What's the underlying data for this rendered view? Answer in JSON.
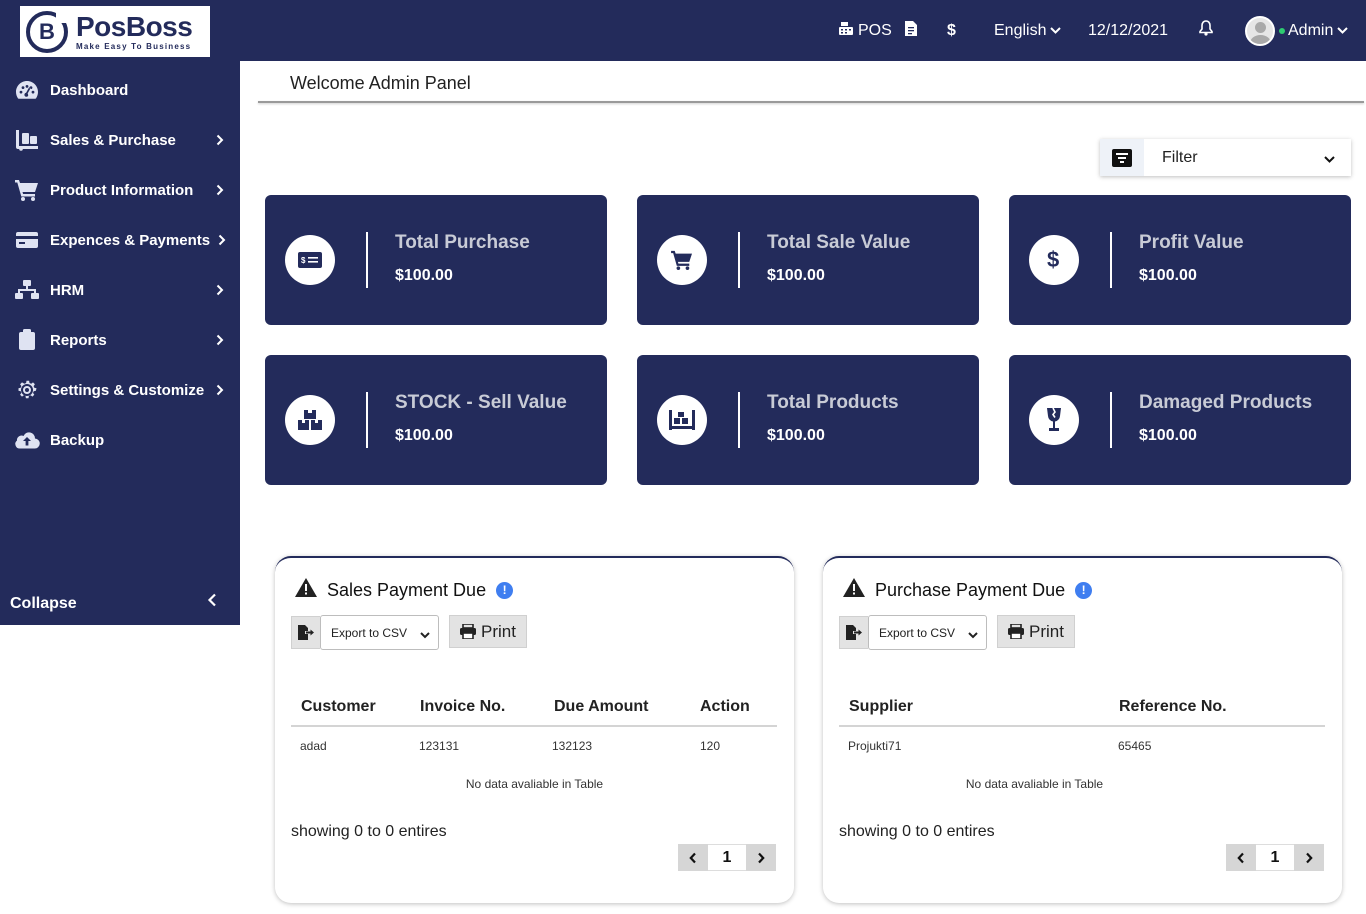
{
  "brand": {
    "name": "PosBoss",
    "tagline": "Make Easy To Business",
    "mark": "B"
  },
  "topbar": {
    "pos_label": "POS",
    "language": "English",
    "date": "12/12/2021",
    "user": "Admin",
    "icons": [
      "cash-register-icon",
      "document-icon",
      "dollar-icon",
      "bell-icon",
      "avatar"
    ]
  },
  "sidebar": {
    "items": [
      {
        "label": "Dashboard",
        "icon": "tachometer-icon",
        "has_submenu": false
      },
      {
        "label": "Sales & Purchase",
        "icon": "dolly-icon",
        "has_submenu": true
      },
      {
        "label": "Product Information",
        "icon": "cart-icon",
        "has_submenu": true
      },
      {
        "label": "Expences & Payments",
        "icon": "credit-card-icon",
        "has_submenu": true
      },
      {
        "label": "HRM",
        "icon": "network-icon",
        "has_submenu": true
      },
      {
        "label": "Reports",
        "icon": "clipboard-icon",
        "has_submenu": true
      },
      {
        "label": "Settings & Customize",
        "icon": "gear-icon",
        "has_submenu": true
      },
      {
        "label": "Backup",
        "icon": "cloud-upload-icon",
        "has_submenu": false
      }
    ],
    "collapse_label": "Collapse"
  },
  "main": {
    "title": "Welcome Admin Panel",
    "filter_label": "Filter",
    "cards": [
      {
        "title": "Total Purchase",
        "value": "$100.00",
        "icon": "money-check-icon"
      },
      {
        "title": "Total Sale Value",
        "value": "$100.00",
        "icon": "cart-icon"
      },
      {
        "title": "Profit Value",
        "value": "$100.00",
        "icon": "dollar-icon"
      },
      {
        "title": "STOCK - Sell Value",
        "value": "$100.00",
        "icon": "boxes-icon"
      },
      {
        "title": "Total Products",
        "value": "$100.00",
        "icon": "pallet-icon"
      },
      {
        "title": "Damaged Products",
        "value": "$100.00",
        "icon": "broken-glass-icon"
      }
    ]
  },
  "sales_due": {
    "title": "Sales Payment Due",
    "export_option": "Export to CSV",
    "print_label": "Print",
    "columns": [
      "Customer",
      "Invoice No.",
      "Due Amount",
      "Action"
    ],
    "rows": [
      [
        "adad",
        "123131",
        "132123",
        "120"
      ]
    ],
    "empty_text": "No data avaliable in Table",
    "showing_text": "showing 0 to 0 entires",
    "page": "1"
  },
  "purchase_due": {
    "title": "Purchase Payment Due",
    "export_option": "Export to CSV",
    "print_label": "Print",
    "columns": [
      "Supplier",
      "Reference No."
    ],
    "rows": [
      [
        "Projukti71",
        "65465"
      ]
    ],
    "empty_text": "No data avaliable in Table",
    "showing_text": "showing 0 to 0 entires",
    "page": "1"
  },
  "colors": {
    "navy": "#232b5b",
    "info_blue": "#3f7ef0",
    "online": "#2ecc71"
  }
}
